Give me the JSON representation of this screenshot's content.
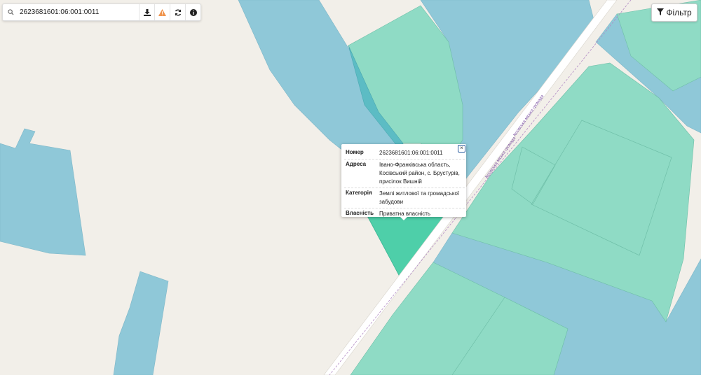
{
  "search": {
    "value": "2623681601:06:001:0011",
    "icon": "search-icon"
  },
  "toolbar": {
    "icons": [
      "download-icon",
      "warning-icon",
      "refresh-icon",
      "info-icon"
    ]
  },
  "filter": {
    "label": "Фільтр",
    "icon": "filter-icon"
  },
  "popup": {
    "close_label": "×",
    "rows": [
      {
        "key": "Номер",
        "value": "2623681601:06:001:0011"
      },
      {
        "key": "Адреса",
        "value": "Івано-Франківська область, Косівський район, с. Брустурів, присілок Вишній"
      },
      {
        "key": "Категорія",
        "value": "Землі житлової та громадської забудови"
      },
      {
        "key": "Власність",
        "value": "Приватна власність"
      }
    ]
  },
  "map": {
    "labels": {
      "road_1": "Косівська міська громада",
      "road_2": "Косівська міська громада"
    },
    "colors": {
      "background": "#f2efe9",
      "blue_parcel": "#8fc8d8",
      "green_parcel": "#8fdbc5",
      "selected_parcel": "#4ecfa9",
      "road": "#ffffff"
    }
  }
}
